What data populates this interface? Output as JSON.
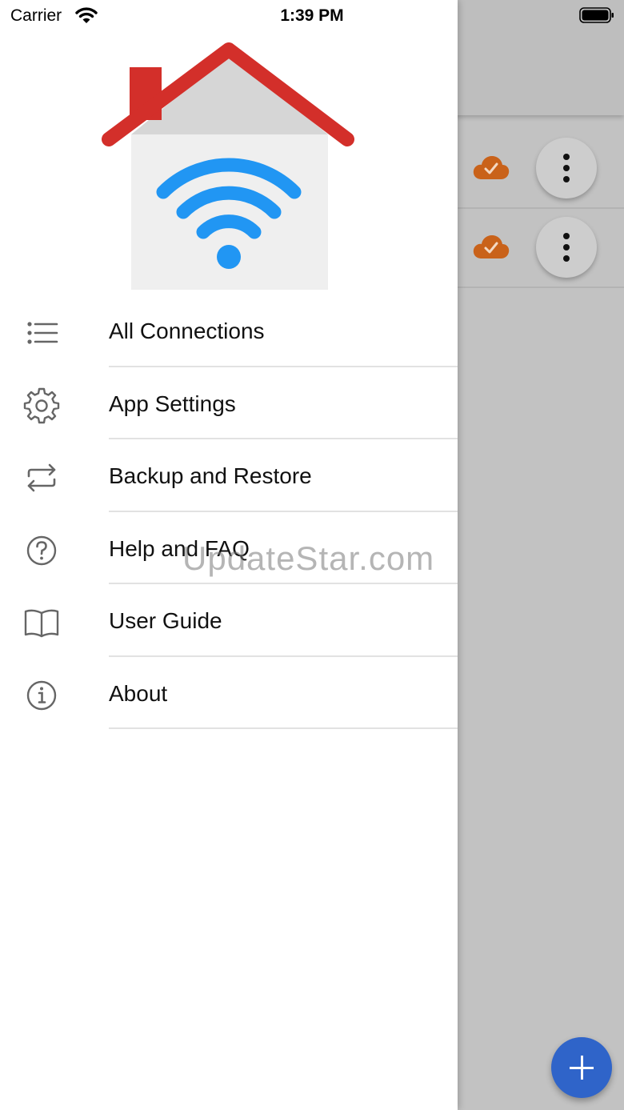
{
  "status_bar": {
    "carrier": "Carrier",
    "time": "1:39 PM"
  },
  "drawer": {
    "items": [
      {
        "label": "All Connections",
        "icon": "list-icon"
      },
      {
        "label": "App Settings",
        "icon": "gear-icon"
      },
      {
        "label": "Backup and Restore",
        "icon": "sync-icon"
      },
      {
        "label": "Help and FAQ",
        "icon": "help-icon"
      },
      {
        "label": "User Guide",
        "icon": "book-icon"
      },
      {
        "label": "About",
        "icon": "info-icon"
      }
    ]
  },
  "watermark": "UpdateStar.com",
  "colors": {
    "accent": "#2f64c9",
    "cloud": "#c9621a",
    "logo_roof": "#d32f2a",
    "logo_wifi": "#2196f3"
  }
}
